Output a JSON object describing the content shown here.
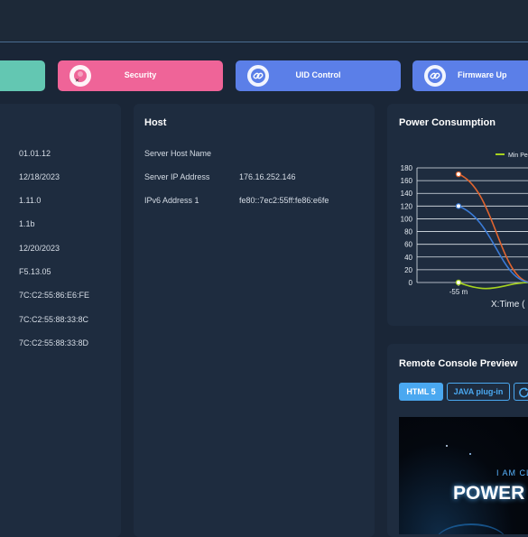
{
  "quick_actions": [
    {
      "label": "",
      "color": "#63c7b2",
      "icon": "none"
    },
    {
      "label": "Security",
      "color": "#ef6498",
      "icon": "security-icon"
    },
    {
      "label": "UID Control",
      "color": "#5b7fe8",
      "icon": "link-icon"
    },
    {
      "label": "Firmware Up",
      "color": "#5b7fe8",
      "icon": "link-icon"
    }
  ],
  "info_panel": {
    "values": [
      "01.01.12",
      "12/18/2023",
      "1.11.0",
      "1.1b",
      "12/20/2023",
      "F5.13.05",
      "7C:C2:55:86:E6:FE",
      "7C:C2:55:88:33:8C",
      "7C:C2:55:88:33:8D"
    ]
  },
  "host": {
    "title": "Host",
    "rows": [
      {
        "label": "Server Host Name",
        "value": ""
      },
      {
        "label": "Server IP Address",
        "value": "176.16.252.146"
      },
      {
        "label": "IPv6 Address 1",
        "value": "fe80::7ec2:55ff:fe86:e6fe"
      }
    ]
  },
  "power": {
    "title": "Power Consumption",
    "legend": "Min Pe",
    "xlabel": "X:Time (",
    "x_tick": "-55 m"
  },
  "chart_data": {
    "type": "line",
    "title": "Power Consumption",
    "xlabel": "X:Time (",
    "x_tick_labels": [
      "-55 m"
    ],
    "y_ticks": [
      0,
      20,
      40,
      60,
      80,
      100,
      120,
      140,
      160,
      180
    ],
    "ylim": [
      0,
      180
    ],
    "grid": true,
    "legend_position": "top-right",
    "series": [
      {
        "name": "Min Pe",
        "color": "#a6d21f",
        "values": [
          0,
          0
        ]
      },
      {
        "color": "#e0642f",
        "values": [
          170,
          0
        ]
      },
      {
        "color": "#3b7bd6",
        "values": [
          120,
          0
        ]
      }
    ]
  },
  "console": {
    "title": "Remote Console Preview",
    "tabs": [
      "HTML 5",
      "JAVA plug-in"
    ],
    "screen_text_1": "I AM CL",
    "screen_text_2": "POWER"
  },
  "colors": {
    "background": "#1a2637",
    "panel": "#1e2c3f",
    "accent": "#4aa8f0"
  }
}
